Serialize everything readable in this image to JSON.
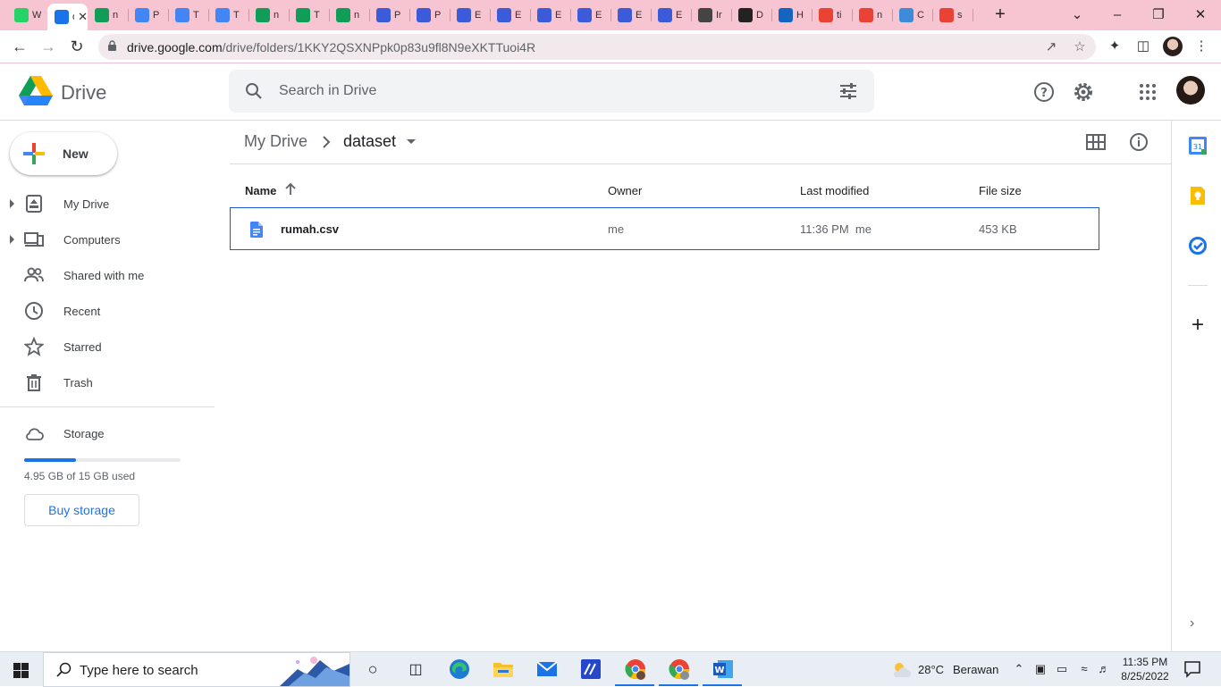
{
  "browser": {
    "tabs": [
      {
        "label": "W",
        "favicon": "whatsapp-icon",
        "color": "#25d366"
      },
      {
        "label": "da",
        "favicon": "drive-icon",
        "color": "#1a73e8",
        "active": true
      },
      {
        "label": "n",
        "favicon": "sheets-icon",
        "color": "#0f9d58"
      },
      {
        "label": "P",
        "favicon": "docs-icon",
        "color": "#4285f4"
      },
      {
        "label": "T",
        "favicon": "docs-icon",
        "color": "#4285f4"
      },
      {
        "label": "T",
        "favicon": "docs-icon",
        "color": "#4285f4"
      },
      {
        "label": "n",
        "favicon": "sheets-icon",
        "color": "#0f9d58"
      },
      {
        "label": "T",
        "favicon": "sheets-icon",
        "color": "#0f9d58"
      },
      {
        "label": "n",
        "favicon": "sheets-icon",
        "color": "#0f9d58"
      },
      {
        "label": "P",
        "favicon": "dribbble-icon",
        "color": "#3b5bdb"
      },
      {
        "label": "P",
        "favicon": "dribbble-icon",
        "color": "#3b5bdb"
      },
      {
        "label": "E",
        "favicon": "dribbble-icon",
        "color": "#3b5bdb"
      },
      {
        "label": "E",
        "favicon": "dribbble-icon",
        "color": "#3b5bdb"
      },
      {
        "label": "E",
        "favicon": "dribbble-icon",
        "color": "#3b5bdb"
      },
      {
        "label": "E",
        "favicon": "dribbble-icon",
        "color": "#3b5bdb"
      },
      {
        "label": "E",
        "favicon": "dribbble-icon",
        "color": "#3b5bdb"
      },
      {
        "label": "E",
        "favicon": "dribbble-icon",
        "color": "#3b5bdb"
      },
      {
        "label": "Ir",
        "favicon": "globe-icon",
        "color": "#444444"
      },
      {
        "label": "D",
        "favicon": "download-icon",
        "color": "#222222"
      },
      {
        "label": "H",
        "favicon": "k-icon",
        "color": "#1565c0"
      },
      {
        "label": "ti",
        "favicon": "google-icon",
        "color": "#ea4335"
      },
      {
        "label": "n",
        "favicon": "google-icon",
        "color": "#ea4335"
      },
      {
        "label": "C",
        "favicon": "canva-icon",
        "color": "#3d8bd9"
      },
      {
        "label": "s",
        "favicon": "google-icon",
        "color": "#ea4335"
      }
    ],
    "url_host": "drive.google.com",
    "url_path": "/drive/folders/1KKY2QSXNPpk0p83u9fl8N9eXKTTuoi4R"
  },
  "drive": {
    "app_name": "Drive",
    "search_placeholder": "Search in Drive",
    "new_label": "New",
    "nav": [
      {
        "label": "My Drive",
        "icon": "my-drive-icon",
        "expandable": true
      },
      {
        "label": "Computers",
        "icon": "computers-icon",
        "expandable": true
      },
      {
        "label": "Shared with me",
        "icon": "shared-icon",
        "expandable": false
      },
      {
        "label": "Recent",
        "icon": "clock-icon",
        "expandable": false
      },
      {
        "label": "Starred",
        "icon": "star-icon",
        "expandable": false
      },
      {
        "label": "Trash",
        "icon": "trash-icon",
        "expandable": false
      }
    ],
    "storage": {
      "label": "Storage",
      "used_text": "4.95 GB of 15 GB used",
      "used_fraction": 0.33,
      "buy_label": "Buy storage"
    },
    "breadcrumb": {
      "root": "My Drive",
      "current": "dataset"
    },
    "columns": {
      "name": "Name",
      "owner": "Owner",
      "modified": "Last modified",
      "size": "File size"
    },
    "files": [
      {
        "name": "rumah.csv",
        "owner": "me",
        "modified": "11:36 PM  me",
        "size": "453 KB"
      }
    ]
  },
  "taskbar": {
    "search_text": "Type here to search",
    "temperature": "28°C",
    "weather": "Berawan",
    "time": "11:35 PM",
    "date": "8/25/2022"
  }
}
